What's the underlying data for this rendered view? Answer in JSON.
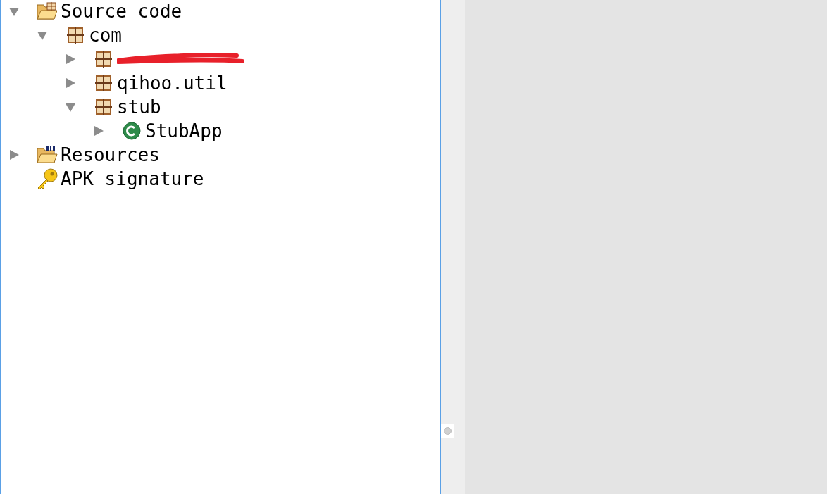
{
  "tree": [
    {
      "kind": "source-folder",
      "label": "Source code",
      "expanded": true,
      "children": [
        {
          "kind": "package",
          "label": "com",
          "expanded": true,
          "children": [
            {
              "kind": "package",
              "redacted": true,
              "expanded": false
            },
            {
              "kind": "package",
              "label": "qihoo.util",
              "expanded": false
            },
            {
              "kind": "package",
              "label": "stub",
              "expanded": true,
              "children": [
                {
                  "kind": "class",
                  "label": "StubApp",
                  "expanded": false
                }
              ]
            }
          ]
        }
      ]
    },
    {
      "kind": "resource-folder",
      "label": "Resources",
      "expanded": false
    },
    {
      "kind": "signature",
      "label": "APK signature"
    }
  ]
}
